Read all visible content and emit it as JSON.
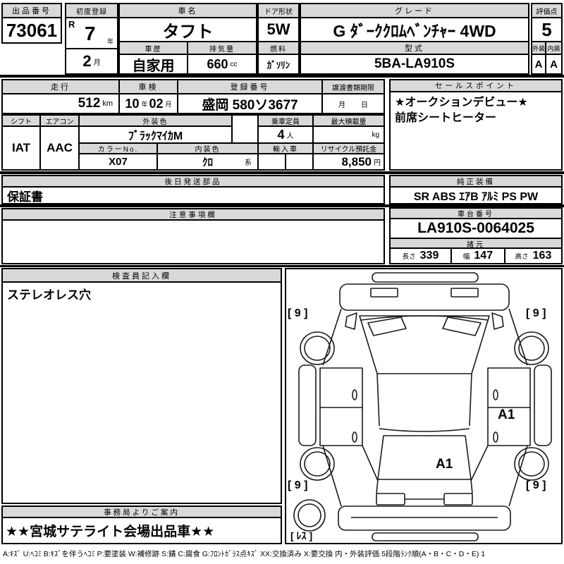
{
  "colors": {
    "header_bg": "#d9d9d9",
    "border": "#000000",
    "text": "#000000"
  },
  "top": {
    "auction_no_label": "出品番号",
    "auction_no": "73061",
    "first_reg_label": "初度登録",
    "era": "R",
    "reg_year": "7",
    "year_unit": "年",
    "reg_month": "2",
    "month_unit": "月",
    "car_name_label": "車名",
    "car_name": "タフト",
    "history_label": "車歴",
    "history": "自家用",
    "displacement_label": "排気量",
    "displacement": "660",
    "displacement_unit": "cc",
    "door_label": "ドア形状",
    "door": "5W",
    "fuel_label": "燃料",
    "fuel": "ｶﾞｿﾘﾝ",
    "grade_label": "グレード",
    "grade": "G ﾀﾞｰｸｸﾛﾑﾍﾞﾝﾁｬｰ 4WD",
    "model_label": "型式",
    "model": "5BA-LA910S",
    "score_label": "評価点",
    "score": "5",
    "ext_label": "外装",
    "ext": "A",
    "int_label": "内装",
    "int": "A"
  },
  "info": {
    "mileage_label": "走行",
    "mileage": "512",
    "mileage_unit": "km",
    "inspection_label": "車検",
    "insp_year": "10",
    "insp_year_unit": "年",
    "insp_month": "02",
    "insp_month_unit": "月",
    "reg_no_label": "登録番号",
    "reg_no": "盛岡 580ソ3677",
    "transfer_label": "譲渡書類期限",
    "transfer_month": "月",
    "transfer_day": "日",
    "shift_label": "シフト",
    "shift": "IAT",
    "aircon_label": "エアコン",
    "aircon": "AAC",
    "ext_color_label": "外装色",
    "ext_color": "ﾌﾞﾗｯｸﾏｲｶM",
    "color_no_label": "カラーNo.",
    "color_no": "X07",
    "int_color_label": "内装色",
    "int_color": "ｸﾛ",
    "int_color_unit": "系",
    "capacity_label": "乗車定員",
    "capacity": "4",
    "capacity_unit": "人",
    "payload_label": "最大積載量",
    "payload": "",
    "payload_unit": "kg",
    "import_label": "輸入車",
    "import_a": "",
    "import_b": "",
    "recycle_label": "リサイクル預託金",
    "recycle": "8,850",
    "recycle_unit": "円"
  },
  "sales": {
    "label": "セールスポイント",
    "line1": "★オークションデビュー★",
    "line2": "前席シートヒーター"
  },
  "parts": {
    "label": "後日発送部品",
    "value": "保証書"
  },
  "equipment": {
    "label": "純正装備",
    "value": "SR ABS ｴｱB ｱﾙﾐ PS PW"
  },
  "notice": {
    "label": "注意事項欄",
    "value": ""
  },
  "chassis": {
    "label": "車台番号",
    "value": "LA910S-0064025"
  },
  "specs": {
    "label": "諸元",
    "length_label": "長さ",
    "length": "339",
    "width_label": "幅",
    "width": "147",
    "height_label": "高さ",
    "height": "163"
  },
  "inspector": {
    "label": "検査員記入欄",
    "value": "ステレオレス穴"
  },
  "office": {
    "label": "事務局よりご案内",
    "value": "★★宮城サテライト会場出品車★★"
  },
  "diagram": {
    "tire_fl": "[ 9 ]",
    "tire_fr": "[ 9 ]",
    "tire_rl": "[ 9 ]",
    "tire_rr": "[ 9 ]",
    "mark_door": "A1",
    "mark_rear": "A1",
    "spare": "[ ﾚｽ ]"
  },
  "footer": {
    "legend": "A:ｷｽﾞ U:ﾍｺﾐ B:ｷｽﾞを伴うﾍｺﾐ P:要塗装 W:補修跡 S:錆 C:腐食 G:ﾌﾛﾝﾄｶﾞﾗｽ点ｷｽﾞ XX:交換済み X:要交換  内・外装評価 5段階ﾗﾝｸ順(A・B・C・D・E) 1"
  }
}
